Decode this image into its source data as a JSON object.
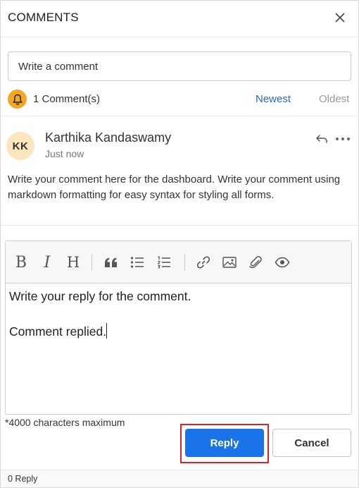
{
  "header": {
    "title": "COMMENTS"
  },
  "comment_input": {
    "placeholder": "Write a comment"
  },
  "summary": {
    "count_label": "1 Comment(s)",
    "sort_newest": "Newest",
    "sort_oldest": "Oldest",
    "bell_color": "#f5a623"
  },
  "comment": {
    "avatar_initials": "KK",
    "author": "Karthika Kandaswamy",
    "time": "Just now",
    "text": "Write your comment here for the dashboard. Write your comment using markdown formatting for easy syntax for styling all forms."
  },
  "editor": {
    "toolbar": {
      "bold_label": "B",
      "italic_label": "I",
      "heading_label": "H"
    },
    "content_line1": "Write your reply for the comment.",
    "content_line2": "Comment replied."
  },
  "max_chars_label": "*4000 characters maximum",
  "buttons": {
    "reply_label": "Reply",
    "cancel_label": "Cancel",
    "reply_color": "#1a73e8"
  },
  "footer": {
    "reply_count": "0 Reply"
  }
}
